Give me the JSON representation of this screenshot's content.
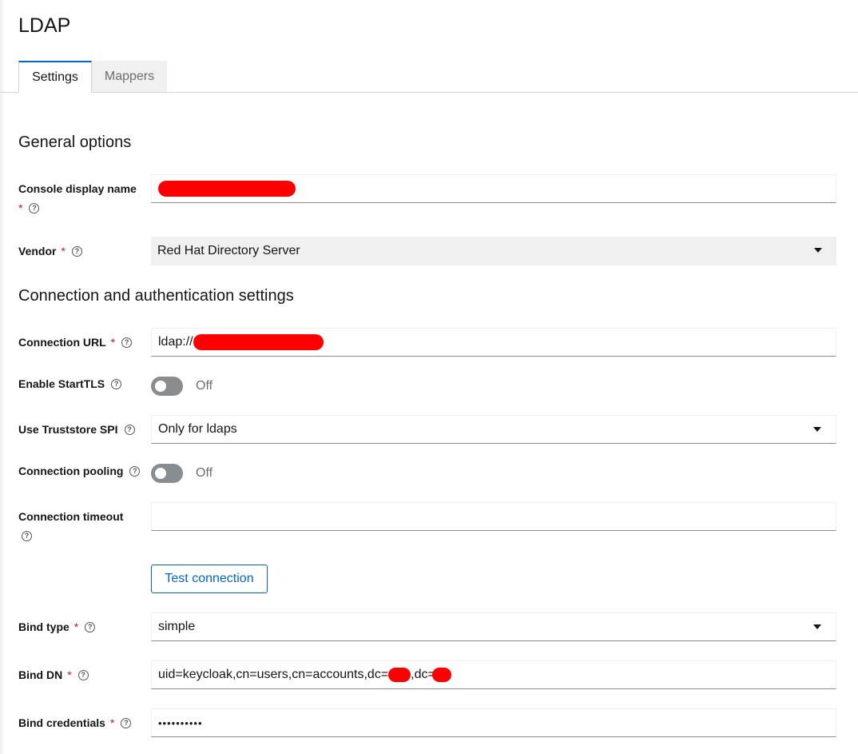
{
  "page": {
    "title": "LDAP"
  },
  "tabs": [
    {
      "label": "Settings",
      "active": true
    },
    {
      "label": "Mappers",
      "active": false
    }
  ],
  "sections": {
    "general": "General options",
    "connection": "Connection and authentication settings"
  },
  "fields": {
    "console_display_name": {
      "label": "Console display name",
      "required": "*",
      "value": ""
    },
    "vendor": {
      "label": "Vendor",
      "required": "*",
      "value": "Red Hat Directory Server"
    },
    "connection_url": {
      "label": "Connection URL",
      "required": "*",
      "value_prefix": "ldap://1"
    },
    "enable_starttls": {
      "label": "Enable StartTLS",
      "state": "Off"
    },
    "use_truststore_spi": {
      "label": "Use Truststore SPI",
      "value": "Only for ldaps"
    },
    "connection_pooling": {
      "label": "Connection pooling",
      "state": "Off"
    },
    "connection_timeout": {
      "label": "Connection timeout",
      "value": ""
    },
    "bind_type": {
      "label": "Bind type",
      "required": "*",
      "value": "simple"
    },
    "bind_dn": {
      "label": "Bind DN",
      "required": "*",
      "value_prefix": "uid=keycloak,cn=users,cn=accounts,dc=",
      "value_mid": ",dc="
    },
    "bind_credentials": {
      "label": "Bind credentials",
      "required": "*",
      "value": "••••••••••"
    }
  },
  "buttons": {
    "test_connection": "Test connection"
  },
  "icons": {
    "help": "help-circle-icon",
    "caret": "caret-down-icon"
  },
  "colors": {
    "accent": "#0066cc",
    "required": "#c9190b",
    "redaction": "#ff0000",
    "toggle_off": "#8a8d90"
  }
}
